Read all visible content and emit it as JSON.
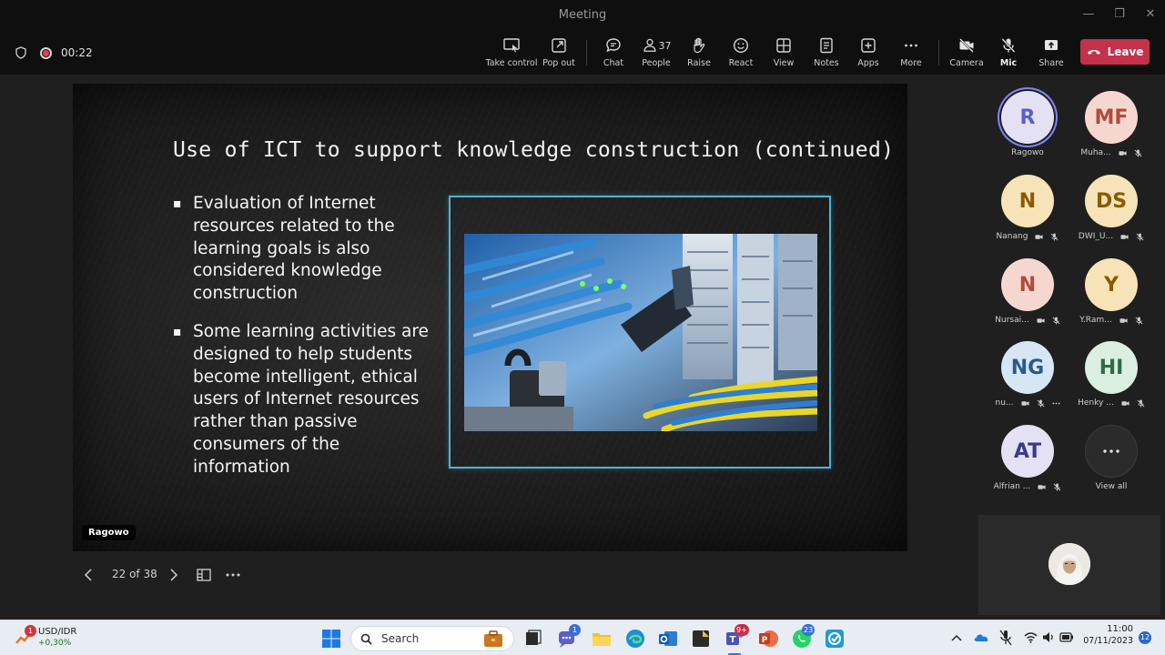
{
  "window": {
    "title": "Meeting"
  },
  "toolbar": {
    "timer": "00:22",
    "buttons": {
      "take_control": "Take control",
      "pop_out": "Pop out",
      "chat": "Chat",
      "people": "People",
      "people_count": "37",
      "raise": "Raise",
      "react": "React",
      "view": "View",
      "notes": "Notes",
      "apps": "Apps",
      "more": "More",
      "camera": "Camera",
      "mic": "Mic",
      "share": "Share"
    },
    "leave": "Leave",
    "leave_color": "#c4314b"
  },
  "slide": {
    "title": "Use of ICT to support knowledge construction (continued)",
    "bullets": [
      "Evaluation of Internet resources related to the learning goals is also considered knowledge construction",
      "Some learning activities are designed to help students become intelligent, ethical users of Internet resources rather than passive consumers of the information"
    ],
    "frame_color": "#4fb4d8",
    "presenter": "Ragowo"
  },
  "slide_nav": {
    "position": "22 of 38"
  },
  "participants": [
    {
      "initials": "R",
      "name": "Ragowo",
      "bg": "#e4e1f5",
      "fg": "#5b5fc7",
      "speaking": true
    },
    {
      "initials": "MF",
      "name": "Muha...",
      "bg": "#f6d7d0",
      "fg": "#b24a3a"
    },
    {
      "initials": "N",
      "name": "Nanang",
      "bg": "#f6e3b8",
      "fg": "#8a5a00"
    },
    {
      "initials": "DS",
      "name": "DWI_U...",
      "bg": "#f6e3b8",
      "fg": "#8a5a00"
    },
    {
      "initials": "N",
      "name": "Nursai...",
      "bg": "#f6d7d0",
      "fg": "#b24a3a"
    },
    {
      "initials": "Y",
      "name": "Y.Ram...",
      "bg": "#f6e3b8",
      "fg": "#8a5a00"
    },
    {
      "initials": "NG",
      "name": "nu...",
      "bg": "#d7e6f5",
      "fg": "#2b5a8a"
    },
    {
      "initials": "HI",
      "name": "Henky ...",
      "bg": "#dbeee2",
      "fg": "#2f6b45"
    },
    {
      "initials": "AT",
      "name": "Alfrian ...",
      "bg": "#e4e1f5",
      "fg": "#3d3a8a"
    }
  ],
  "view_all": "View all",
  "taskbar": {
    "ticker_name": "USD/IDR",
    "ticker_change": "+0,30%",
    "ticker_badge": "1",
    "search_placeholder": "Search",
    "chat_badge": "1",
    "teams_badge": "9+",
    "whatsapp_badge": "23",
    "time": "11:00",
    "date": "07/11/2023",
    "notif_count": "12"
  }
}
